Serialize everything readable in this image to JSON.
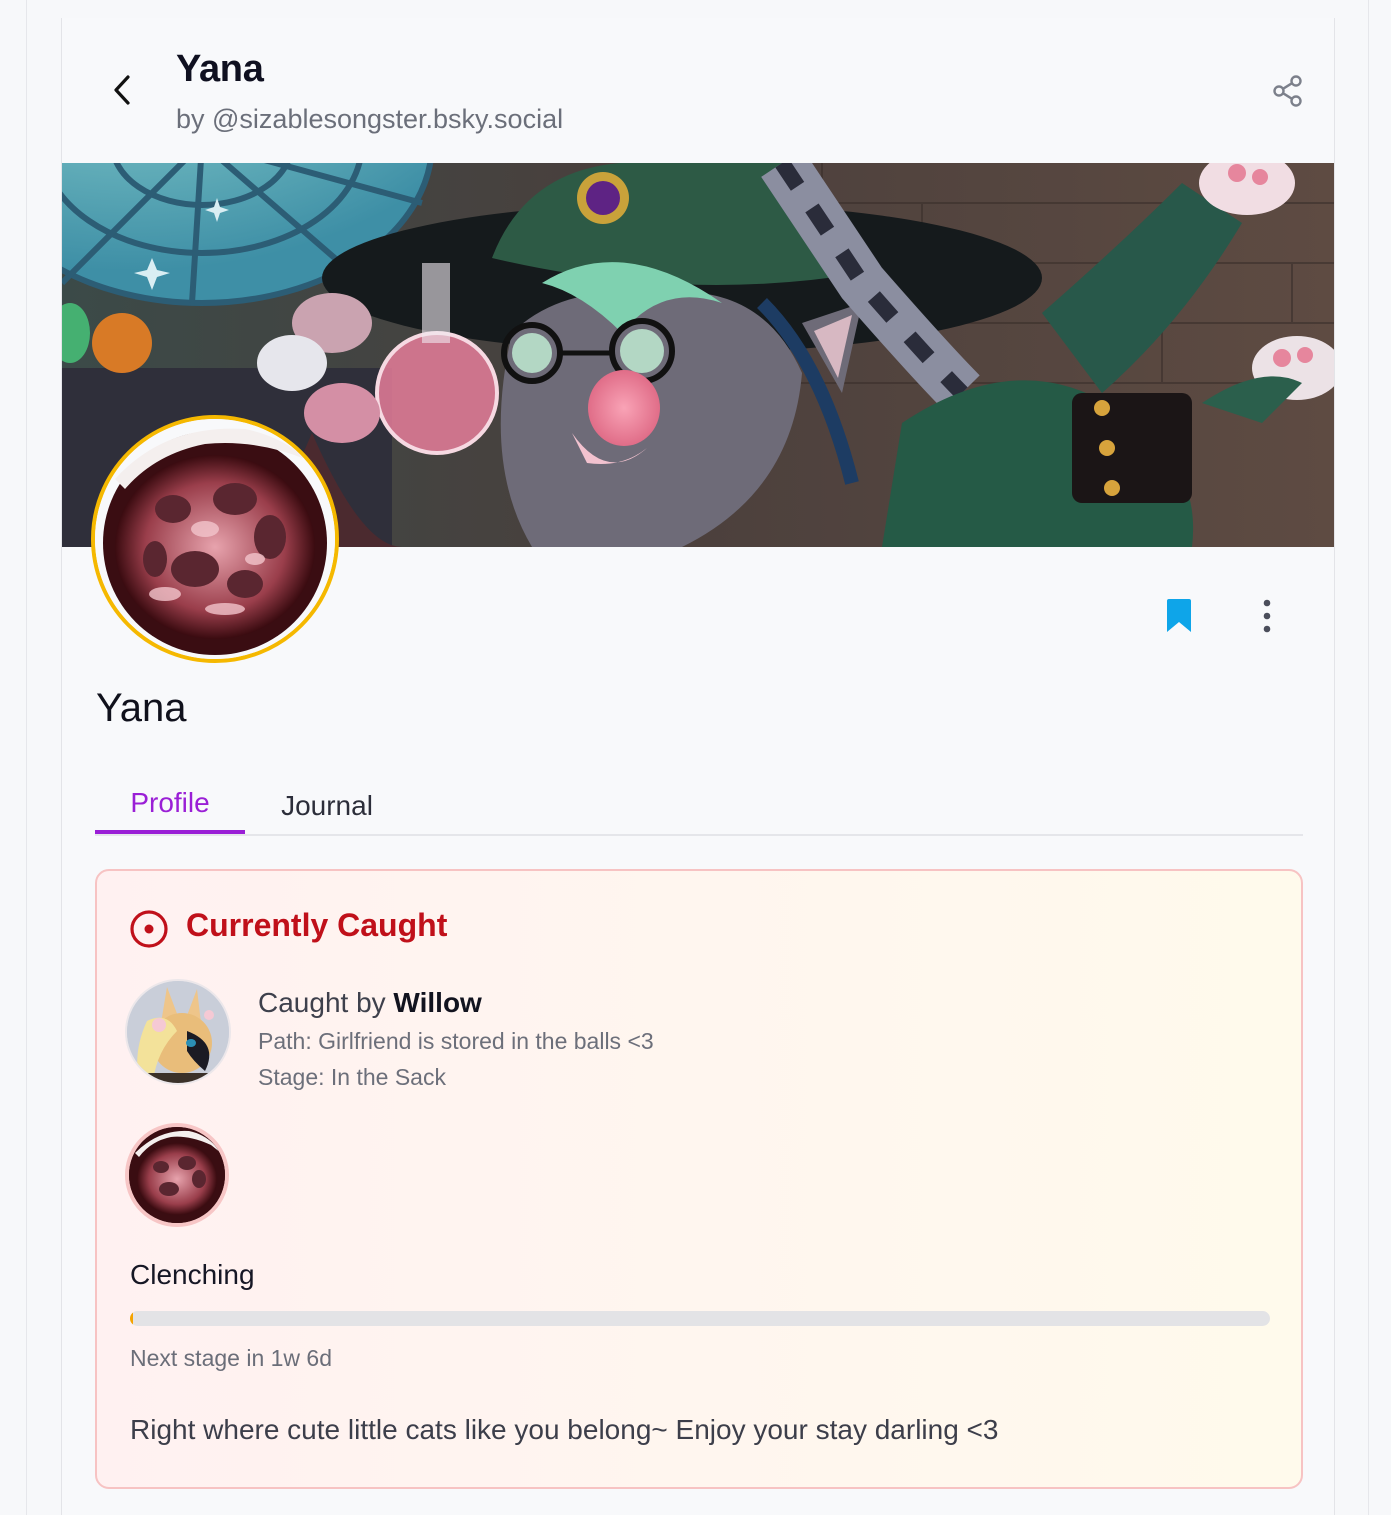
{
  "header": {
    "title": "Yana",
    "subtitle": "by @sizablesongster.bsky.social"
  },
  "profile": {
    "name": "Yana",
    "avatar_ring_color": "#f5b800",
    "bookmark_color": "#0ea5e9"
  },
  "tabs": [
    {
      "label": "Profile",
      "active": true
    },
    {
      "label": "Journal",
      "active": false
    }
  ],
  "caught": {
    "title": "Currently Caught",
    "caught_by_prefix": "Caught by",
    "captor_name": "Willow",
    "path": "Path: Girlfriend is stored in the balls <3",
    "stage": "Stage: In the Sack",
    "stage_name": "Clenching",
    "progress_fraction": 0.003,
    "next_stage": "Next stage in 1w 6d",
    "message": "Right where cute little cats like you belong~ Enjoy your stay darling <3",
    "title_color": "#c0101a"
  },
  "accent_color": "#9a1fd6",
  "icons": {
    "back": "chevron-left-icon",
    "share": "share-icon",
    "bookmark": "bookmark-icon",
    "more": "more-vertical-icon",
    "caught": "target-icon"
  }
}
